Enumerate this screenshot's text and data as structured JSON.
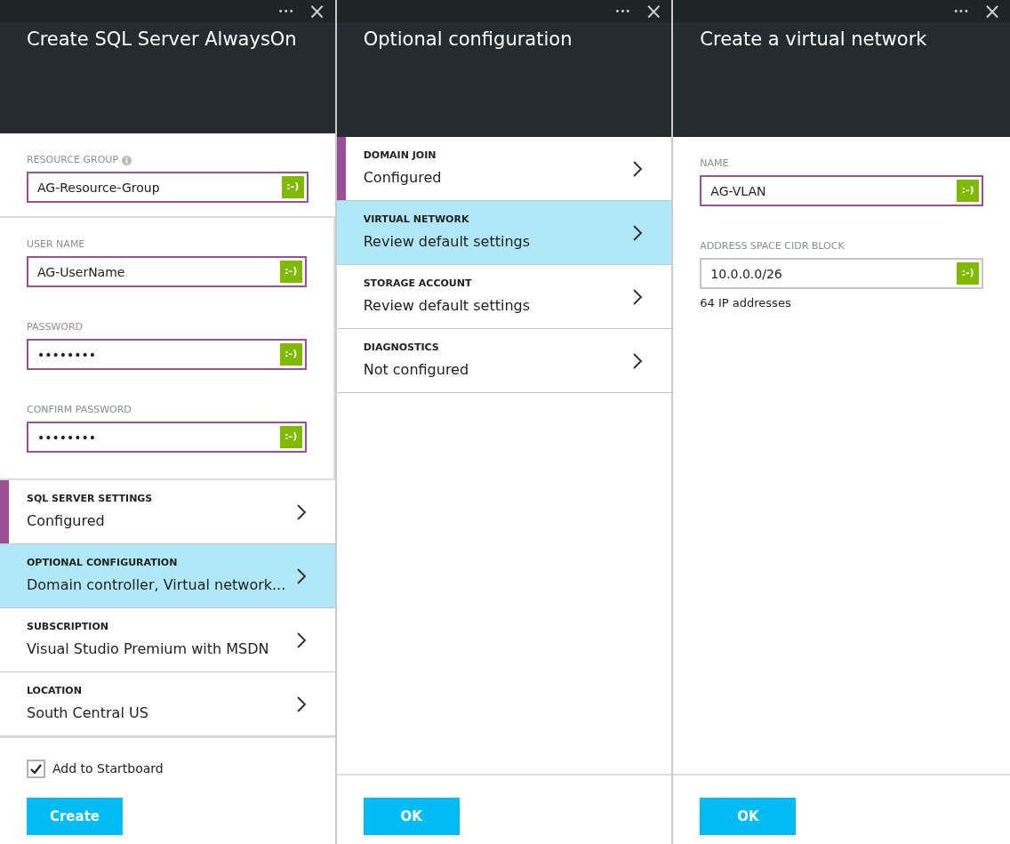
{
  "blades": [
    {
      "title": "Create SQL Server AlwaysOn",
      "toolbar": {
        "more": "•••",
        "close": "×"
      },
      "content": [
        {
          "kind": "field",
          "label": "RESOURCE GROUP",
          "info": true,
          "value": "AG-Resource-Group",
          "highlighted": true,
          "status": ":-)"
        },
        {
          "kind": "group",
          "fields": [
            {
              "kind": "field",
              "label": "USER NAME",
              "info": false,
              "value": "AG-UserName",
              "highlighted": true,
              "status": ":-)"
            },
            {
              "kind": "field",
              "label": "PASSWORD",
              "info": false,
              "value": "••••••••",
              "highlighted": true,
              "status": ":-)"
            },
            {
              "kind": "field",
              "label": "CONFIRM PASSWORD",
              "info": false,
              "value": "••••••••",
              "highlighted": true,
              "status": ":-)"
            }
          ]
        },
        {
          "kind": "nav",
          "label": "SQL SERVER SETTINGS",
          "value": "Configured",
          "configured": true,
          "selected": false
        },
        {
          "kind": "nav",
          "label": "OPTIONAL CONFIGURATION",
          "value": "Domain controller, Virtual network...",
          "configured": false,
          "selected": true
        },
        {
          "kind": "nav",
          "label": "SUBSCRIPTION",
          "value": "Visual Studio Premium with MSDN",
          "configured": false,
          "selected": false
        },
        {
          "kind": "nav",
          "label": "LOCATION",
          "value": "South Central US",
          "configured": false,
          "selected": false
        }
      ],
      "footer": {
        "checkbox": {
          "label": "Add to Startboard",
          "checked": true
        },
        "button": "Create"
      }
    },
    {
      "title": "Optional configuration",
      "toolbar": {
        "more": "•••",
        "close": "×"
      },
      "content": [
        {
          "kind": "nav",
          "label": "DOMAIN JOIN",
          "value": "Configured",
          "configured": true,
          "selected": false
        },
        {
          "kind": "nav",
          "label": "VIRTUAL NETWORK",
          "value": "Review default settings",
          "configured": false,
          "selected": true
        },
        {
          "kind": "nav",
          "label": "STORAGE ACCOUNT",
          "value": "Review default settings",
          "configured": false,
          "selected": false
        },
        {
          "kind": "nav",
          "label": "DIAGNOSTICS",
          "value": "Not configured",
          "configured": false,
          "selected": false
        }
      ],
      "footer": {
        "button": "OK"
      }
    },
    {
      "title": "Create a virtual network",
      "toolbar": {
        "more": "•••",
        "close": "×"
      },
      "content": [
        {
          "kind": "field",
          "label": "NAME",
          "info": false,
          "value": "AG-VLAN",
          "highlighted": true,
          "status": ":-)"
        },
        {
          "kind": "field",
          "label": "ADDRESS SPACE CIDR BLOCK",
          "info": false,
          "value": "10.0.0.0/26",
          "highlighted": false,
          "status": ":-)",
          "note": "64 IP addresses"
        }
      ],
      "footer": {
        "button": "OK"
      }
    }
  ]
}
